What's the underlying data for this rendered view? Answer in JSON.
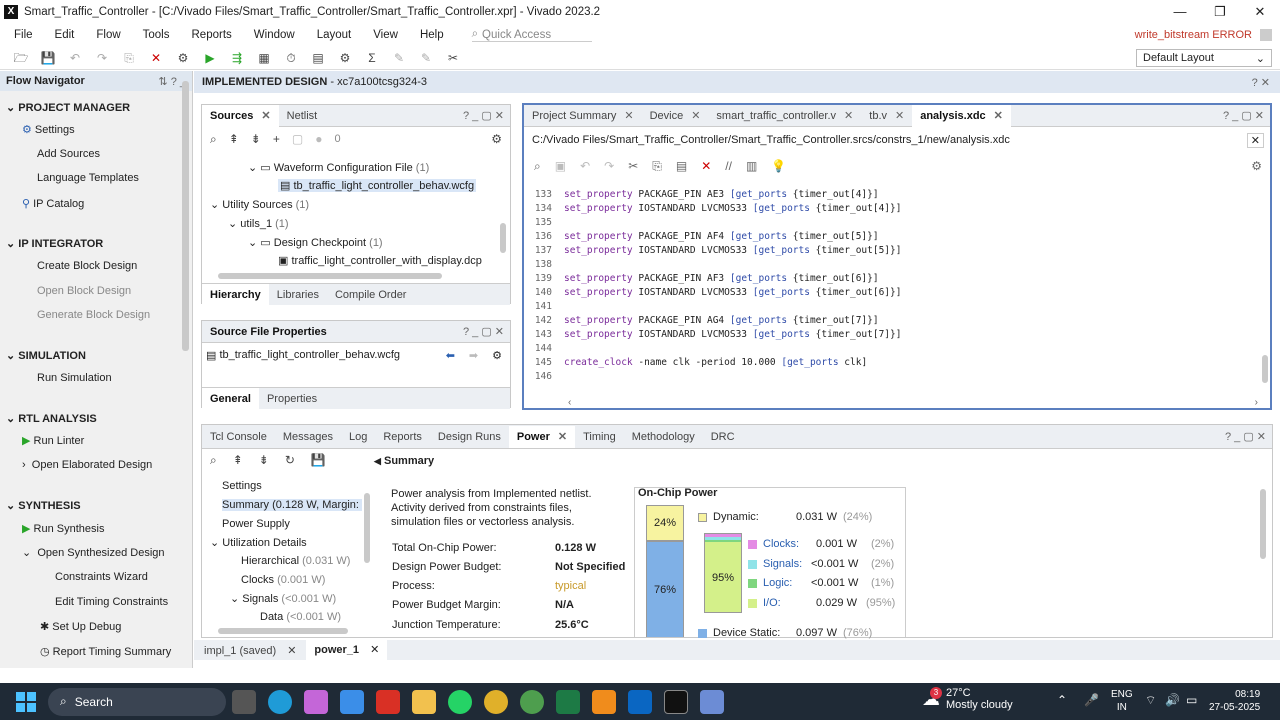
{
  "app": {
    "title": "Smart_Traffic_Controller - [C:/Vivado Files/Smart_Traffic_Controller/Smart_Traffic_Controller.xpr] - Vivado 2023.2",
    "error": "write_bitstream ERROR",
    "layout": "Default Layout"
  },
  "menu": [
    "File",
    "Edit",
    "Flow",
    "Tools",
    "Reports",
    "Window",
    "Layout",
    "View",
    "Help"
  ],
  "quick_access": "Quick Access",
  "flow_nav": {
    "title": "Flow Navigator",
    "project_manager": "PROJECT MANAGER",
    "settings": "Settings",
    "add_sources": "Add Sources",
    "lang_templates": "Language Templates",
    "ip_catalog": "IP Catalog",
    "ip_integrator": "IP INTEGRATOR",
    "create_bd": "Create Block Design",
    "open_bd": "Open Block Design",
    "gen_bd": "Generate Block Design",
    "simulation": "SIMULATION",
    "run_sim": "Run Simulation",
    "rtl": "RTL ANALYSIS",
    "run_linter": "Run Linter",
    "open_elab": "Open Elaborated Design",
    "synthesis": "SYNTHESIS",
    "run_synth": "Run Synthesis",
    "open_synth": "Open Synthesized Design",
    "constraints_wizard": "Constraints Wizard",
    "edit_timing": "Edit Timing Constraints",
    "setup_debug": "Set Up Debug",
    "report_timing": "Report Timing Summary"
  },
  "impl_header": {
    "title": "IMPLEMENTED DESIGN",
    "part": "- xc7a100tcsg324-3"
  },
  "sources": {
    "tabs": [
      "Sources",
      "Netlist"
    ],
    "count": "0",
    "tree": [
      {
        "label": "Waveform Configuration File",
        "count": "(1)"
      },
      {
        "label": "tb_traffic_light_controller_behav.wcfg",
        "count": ""
      },
      {
        "label": "Utility Sources",
        "count": "(1)"
      },
      {
        "label": "utils_1",
        "count": "(1)"
      },
      {
        "label": "Design Checkpoint",
        "count": "(1)"
      },
      {
        "label": "traffic_light_controller_with_display.dcp",
        "count": ""
      }
    ],
    "subtabs": [
      "Hierarchy",
      "Libraries",
      "Compile Order"
    ]
  },
  "sfp": {
    "title": "Source File Properties",
    "file": "tb_traffic_light_controller_behav.wcfg",
    "subtabs": [
      "General",
      "Properties"
    ]
  },
  "editor": {
    "tabs": [
      "Project Summary",
      "Device",
      "smart_traffic_controller.v",
      "tb.v",
      "analysis.xdc"
    ],
    "path": "C:/Vivado Files/Smart_Traffic_Controller/Smart_Traffic_Controller.srcs/constrs_1/new/analysis.xdc",
    "lines": [
      {
        "n": "133",
        "t": "set_property PACKAGE_PIN AE3 [get_ports {timer_out[4]}]"
      },
      {
        "n": "134",
        "t": "set_property IOSTANDARD LVCMOS33 [get_ports {timer_out[4]}]"
      },
      {
        "n": "135",
        "t": ""
      },
      {
        "n": "136",
        "t": "set_property PACKAGE_PIN AF4 [get_ports {timer_out[5]}]"
      },
      {
        "n": "137",
        "t": "set_property IOSTANDARD LVCMOS33 [get_ports {timer_out[5]}]"
      },
      {
        "n": "138",
        "t": ""
      },
      {
        "n": "139",
        "t": "set_property PACKAGE_PIN AF3 [get_ports {timer_out[6]}]"
      },
      {
        "n": "140",
        "t": "set_property IOSTANDARD LVCMOS33 [get_ports {timer_out[6]}]"
      },
      {
        "n": "141",
        "t": ""
      },
      {
        "n": "142",
        "t": "set_property PACKAGE_PIN AG4 [get_ports {timer_out[7]}]"
      },
      {
        "n": "143",
        "t": "set_property IOSTANDARD LVCMOS33 [get_ports {timer_out[7]}]"
      },
      {
        "n": "144",
        "t": ""
      },
      {
        "n": "145",
        "t": "create_clock -name clk -period 10.000 [get_ports clk]"
      },
      {
        "n": "146",
        "t": ""
      }
    ]
  },
  "bottom": {
    "tabs": [
      "Tcl Console",
      "Messages",
      "Log",
      "Reports",
      "Design Runs",
      "Power",
      "Timing",
      "Methodology",
      "DRC"
    ],
    "tree": [
      {
        "label": "Settings",
        "extra": ""
      },
      {
        "label": "Summary (0.128 W, Margin: N/A",
        "extra": ""
      },
      {
        "label": "Power Supply",
        "extra": ""
      },
      {
        "label": "Utilization Details",
        "extra": ""
      },
      {
        "label": "Hierarchical",
        "extra": "(0.031 W)"
      },
      {
        "label": "Clocks",
        "extra": "(0.001 W)"
      },
      {
        "label": "Signals",
        "extra": "(<0.001 W)"
      },
      {
        "label": "Data",
        "extra": "(<0.001 W)"
      }
    ],
    "summary_title": "Summary",
    "intro": "Power analysis from Implemented netlist. Activity derived from constraints files, simulation files or vectorless analysis.",
    "props": [
      {
        "k": "Total On-Chip Power:",
        "v": "0.128 W"
      },
      {
        "k": "Design Power Budget:",
        "v": "Not Specified"
      },
      {
        "k": "Process:",
        "v": "typical"
      },
      {
        "k": "Power Budget Margin:",
        "v": "N/A"
      },
      {
        "k": "Junction Temperature:",
        "v": "25.6°C"
      }
    ],
    "onchip": {
      "title": "On-Chip Power",
      "dyn_pct": "24%",
      "static_pct": "76%",
      "inner_pct": "95%",
      "dynamic": {
        "label": "Dynamic:",
        "w": "0.031 W",
        "p": "(24%)"
      },
      "rows": [
        {
          "label": "Clocks:",
          "w": "0.001 W",
          "p": "(2%)",
          "color": "#e48be4"
        },
        {
          "label": "Signals:",
          "w": "<0.001 W",
          "p": "(2%)",
          "color": "#8fe3e8"
        },
        {
          "label": "Logic:",
          "w": "<0.001 W",
          "p": "(1%)",
          "color": "#7fd67f"
        },
        {
          "label": "I/O:",
          "w": "0.029 W",
          "p": "(95%)",
          "color": "#d4f08a"
        }
      ],
      "static": {
        "label": "Device Static:",
        "w": "0.097 W",
        "p": "(76%)"
      }
    }
  },
  "doc_tabs": [
    {
      "label": "impl_1 (saved)"
    },
    {
      "label": "power_1"
    }
  ],
  "taskbar": {
    "search": "Search",
    "weather_temp": "27°C",
    "weather_desc": "Mostly cloudy",
    "badge": "3",
    "lang1": "ENG",
    "lang2": "IN",
    "time": "08:19",
    "date": "27-05-2025"
  }
}
